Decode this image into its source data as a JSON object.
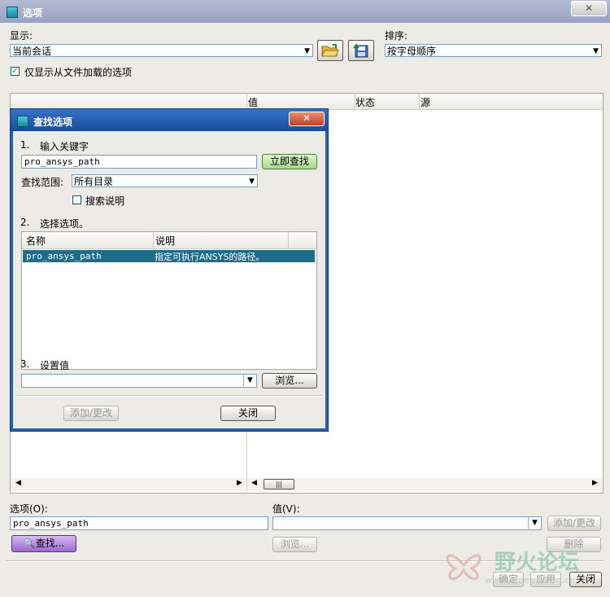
{
  "window": {
    "title": "选项",
    "close_label": "✕"
  },
  "display": {
    "label": "显示:",
    "value": "当前会话"
  },
  "sort": {
    "label": "排序:",
    "value": "按字母顺序"
  },
  "show_loaded": {
    "label": "仅显示从文件加载的选项",
    "checked": true
  },
  "table": {
    "columns": [
      "值",
      "状态",
      "源"
    ]
  },
  "find_dialog": {
    "title": "查找选项",
    "close_label": "✕",
    "step1": {
      "number": "1.",
      "label": "输入关键字"
    },
    "keyword": "pro_ansys_path",
    "search_now": "立即查找",
    "scope_label": "查找范围:",
    "scope_value": "所有目录",
    "search_desc": {
      "label": "搜索说明",
      "checked": false
    },
    "step2": {
      "number": "2.",
      "label": "选择选项。"
    },
    "list": {
      "columns": [
        "名称",
        "说明"
      ],
      "rows": [
        {
          "name": "pro_ansys_path",
          "desc": "指定可执行ANSYS的路径。"
        }
      ]
    },
    "step3": {
      "number": "3.",
      "label": "设置值"
    },
    "value": "",
    "browse": "浏览...",
    "add_change": "添加/更改",
    "close": "关闭"
  },
  "bottom": {
    "option_label": "选项(O):",
    "option_value": "pro_ansys_path",
    "value_label": "值(V):",
    "value_value": "",
    "add_change": "添加/更改",
    "find": "查找...",
    "browse": "浏览...",
    "delete": "删除",
    "ok": "确定",
    "apply": "应用",
    "close": "关闭"
  },
  "watermark": {
    "text": "野火论坛",
    "sub": "www.proewildfire.cn"
  }
}
